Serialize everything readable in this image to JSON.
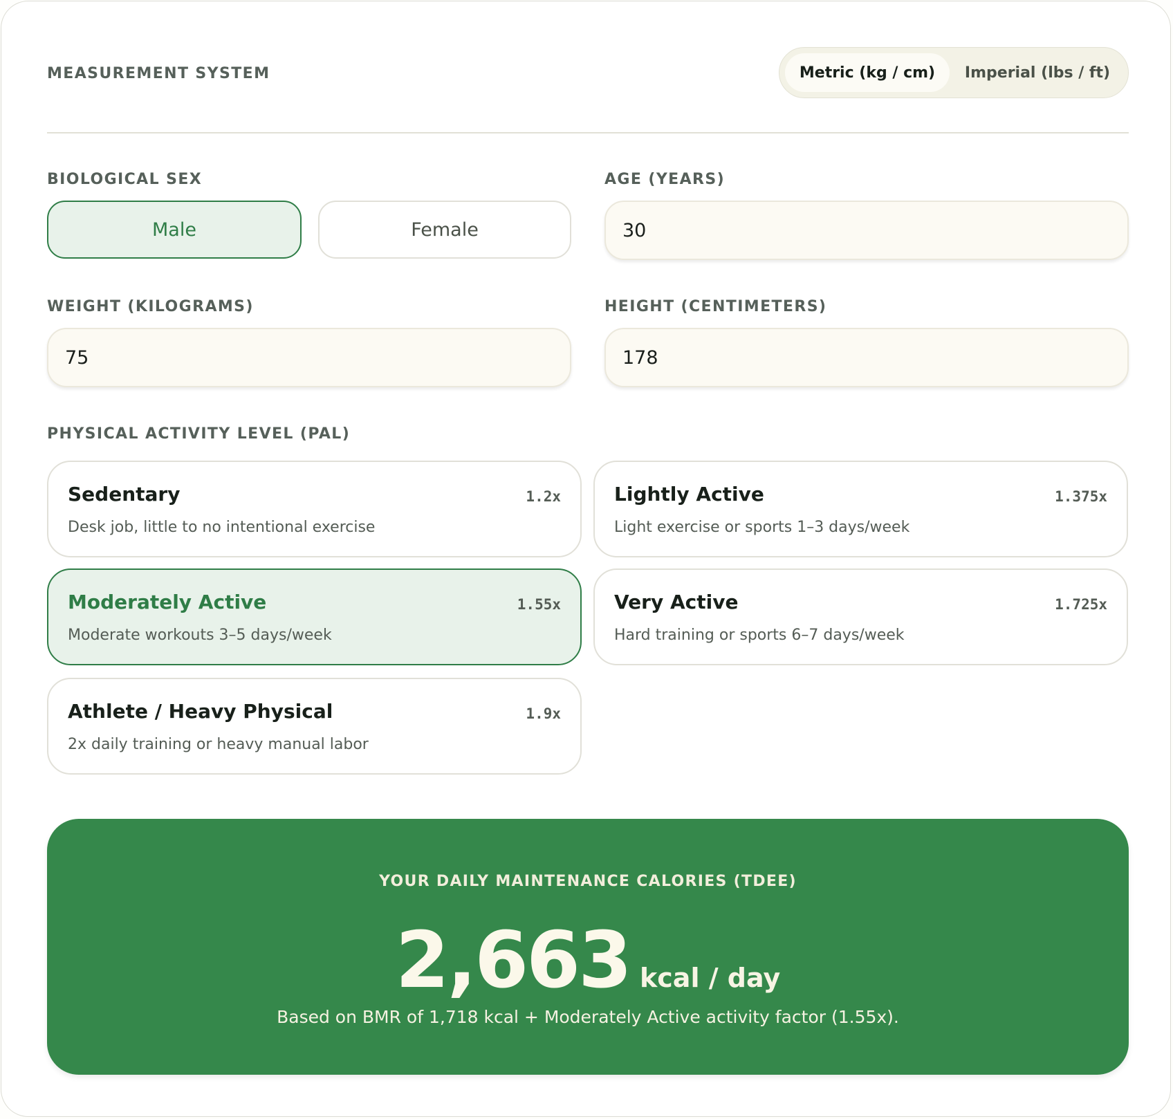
{
  "measurement": {
    "label": "MEASUREMENT SYSTEM",
    "options": [
      {
        "label": "Metric (kg / cm)",
        "selected": true
      },
      {
        "label": "Imperial (lbs / ft)",
        "selected": false
      }
    ]
  },
  "sex": {
    "label": "BIOLOGICAL SEX",
    "options": [
      {
        "label": "Male",
        "selected": true
      },
      {
        "label": "Female",
        "selected": false
      }
    ]
  },
  "age": {
    "label": "AGE (YEARS)",
    "value": "30"
  },
  "weight": {
    "label": "WEIGHT (KILOGRAMS)",
    "value": "75"
  },
  "height": {
    "label": "HEIGHT (CENTIMETERS)",
    "value": "178"
  },
  "activity": {
    "label": "PHYSICAL ACTIVITY LEVEL (PAL)",
    "options": [
      {
        "title": "Sedentary",
        "desc": "Desk job, little to no intentional exercise",
        "multiplier": "1.2x",
        "selected": false
      },
      {
        "title": "Lightly Active",
        "desc": "Light exercise or sports 1–3 days/week",
        "multiplier": "1.375x",
        "selected": false
      },
      {
        "title": "Moderately Active",
        "desc": "Moderate workouts 3–5 days/week",
        "multiplier": "1.55x",
        "selected": true
      },
      {
        "title": "Very Active",
        "desc": "Hard training or sports 6–7 days/week",
        "multiplier": "1.725x",
        "selected": false
      },
      {
        "title": "Athlete / Heavy Physical",
        "desc": "2x daily training or heavy manual labor",
        "multiplier": "1.9x",
        "selected": false
      }
    ]
  },
  "result": {
    "label": "YOUR DAILY MAINTENANCE CALORIES (TDEE)",
    "value": "2,663",
    "unit": "kcal / day",
    "note": "Based on BMR of 1,718 kcal + Moderately Active activity factor (1.55x)."
  },
  "colors": {
    "accent": "#35884b",
    "accent_text": "#2f7d47",
    "selected_bg": "#e8f2ea",
    "input_bg": "#fcfaf3"
  }
}
